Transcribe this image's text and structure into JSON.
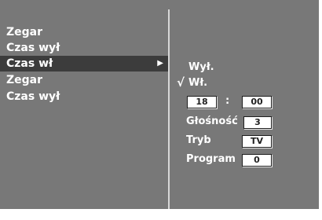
{
  "left_menu": {
    "items": [
      {
        "label": "Zegar"
      },
      {
        "label": "Czas wył"
      },
      {
        "label": "Czas wł",
        "selected": true,
        "arrow": "▶"
      },
      {
        "label": "Zegar"
      },
      {
        "label": "Czas wył"
      }
    ]
  },
  "submenu": {
    "off_label": "Wył.",
    "on_label": "Wł.",
    "check_mark": "√",
    "hour": "18",
    "minute": "00",
    "time_separator": ":",
    "volume_label": "Głośność",
    "volume_value": "3",
    "mode_label": "Tryb",
    "mode_value": "TV",
    "program_label": "Program",
    "program_value": "0"
  },
  "colors": {
    "panel_bg": "#787878",
    "selected_bg": "#3c3c3c",
    "divider": "#d8d8d8",
    "text": "#ffffff",
    "value_box_bg": "#ffffff",
    "value_box_text": "#222222"
  }
}
